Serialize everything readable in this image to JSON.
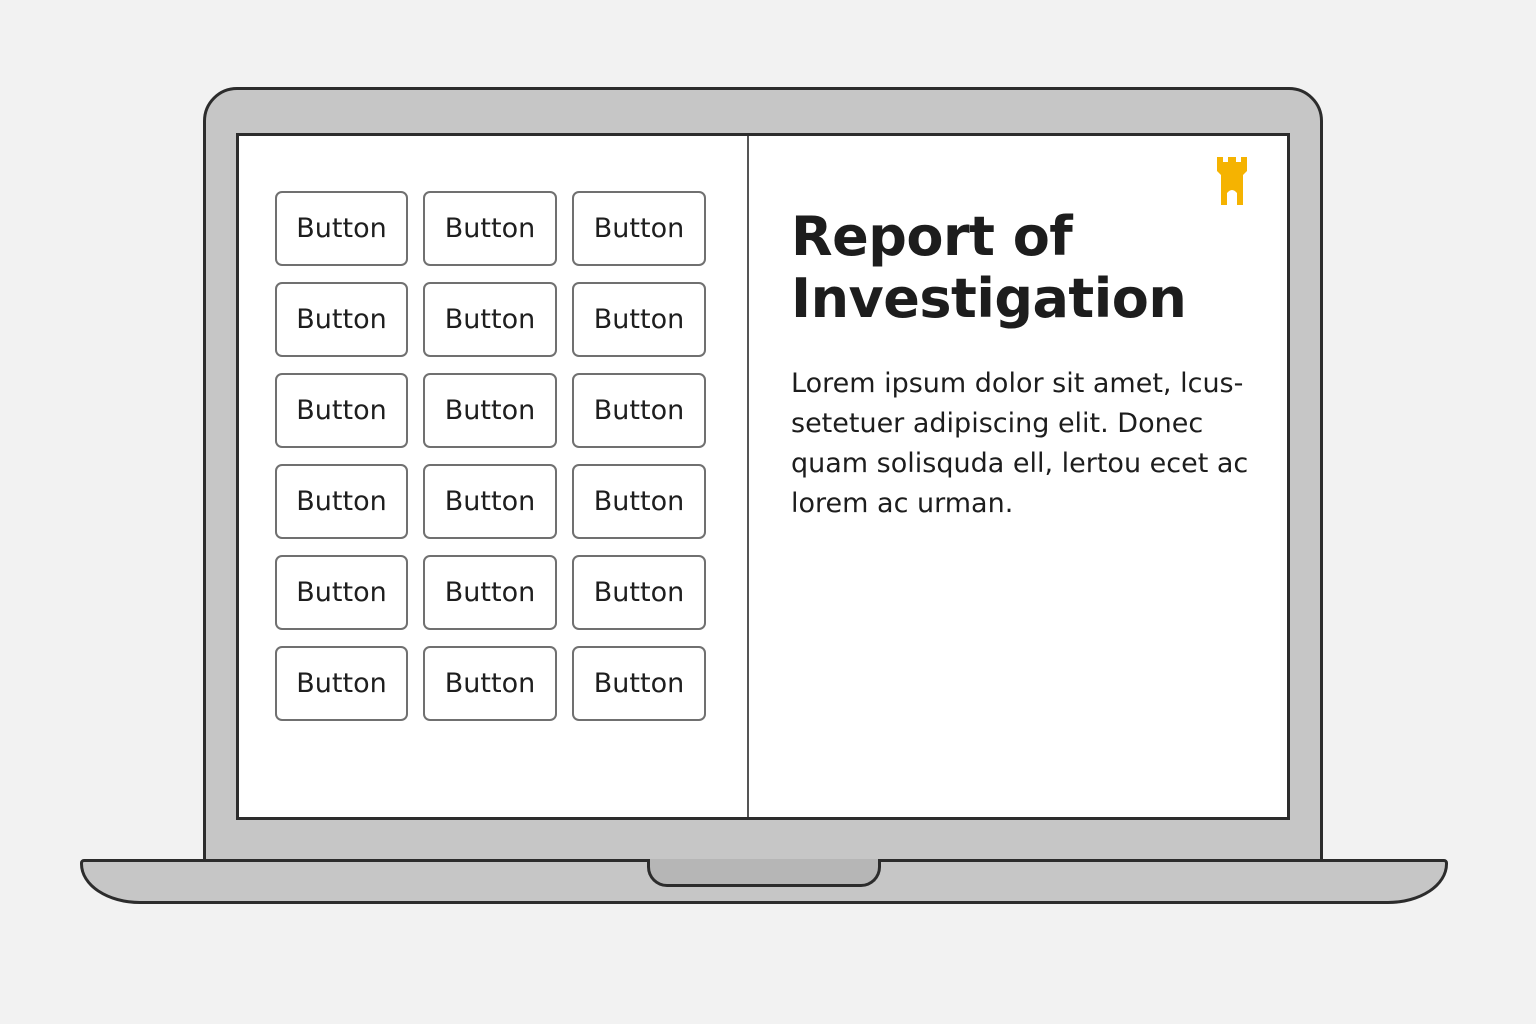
{
  "left_panel": {
    "buttons": [
      {
        "label": "Button"
      },
      {
        "label": "Button"
      },
      {
        "label": "Button"
      },
      {
        "label": "Button"
      },
      {
        "label": "Button"
      },
      {
        "label": "Button"
      },
      {
        "label": "Button"
      },
      {
        "label": "Button"
      },
      {
        "label": "Button"
      },
      {
        "label": "Button"
      },
      {
        "label": "Button"
      },
      {
        "label": "Button"
      },
      {
        "label": "Button"
      },
      {
        "label": "Button"
      },
      {
        "label": "Button"
      },
      {
        "label": "Button"
      },
      {
        "label": "Button"
      },
      {
        "label": "Button"
      }
    ]
  },
  "right_panel": {
    "logo_icon": "castle-tower-icon",
    "title": "Report of Investigation",
    "body": "Lorem ipsum dolor sit amet, lcus-setetuer adipiscing elit. Donec quam solisquda ell, lertou ecet ac lorem ac urman."
  },
  "colors": {
    "background": "#f2f2f2",
    "device_body": "#c6c6c6",
    "outline": "#2c2c2c",
    "screen": "#ffffff",
    "logo": "#f5b301"
  }
}
